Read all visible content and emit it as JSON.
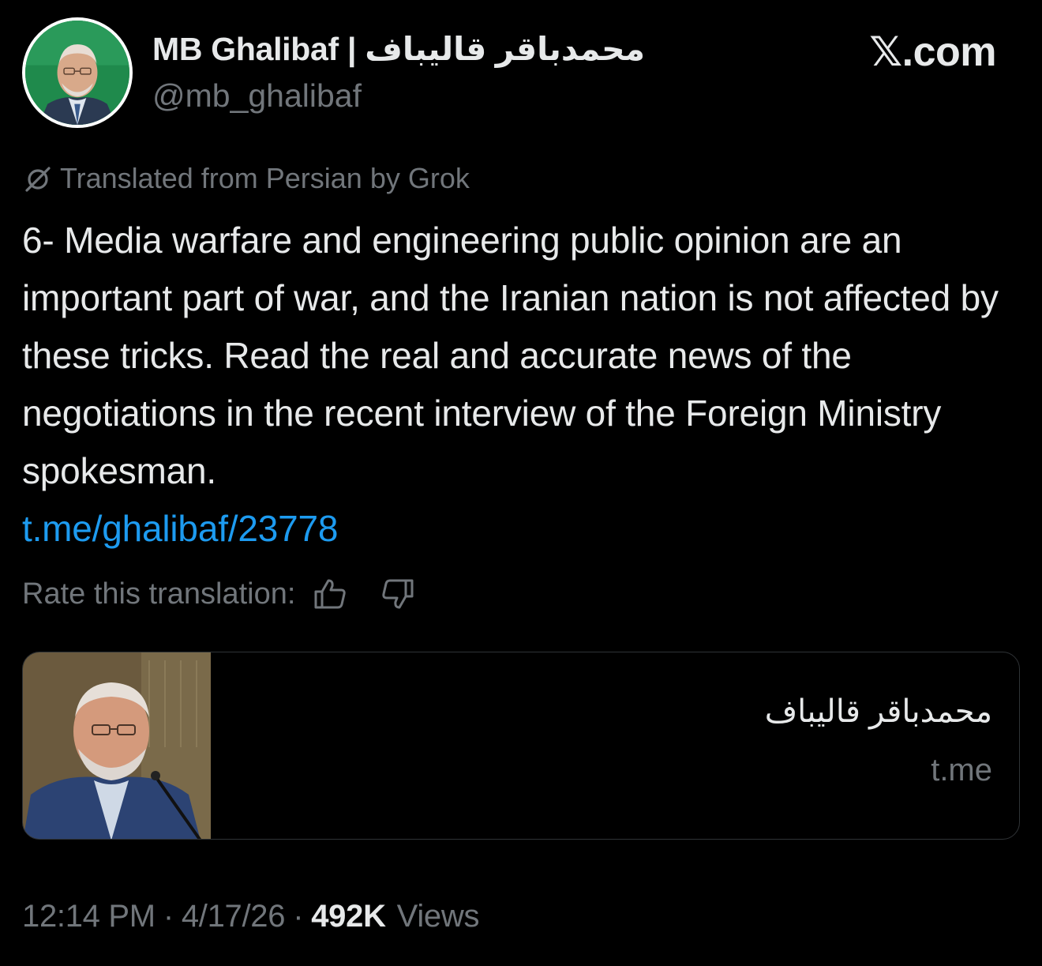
{
  "tweet": {
    "author": {
      "display_name": "MB Ghalibaf | محمدباقر قالیباف",
      "handle": "@mb_ghalibaf",
      "avatar": "profile-photo"
    },
    "brand": "𝕏.com",
    "translation_note": "Translated from Persian by Grok",
    "text": "6- Media warfare and engineering public opinion are an important part of war, and the Iranian nation is not affected by these tricks. Read the real and accurate news of the negotiations in the recent interview of the Foreign Ministry spokesman.",
    "link": "t.me/ghalibaf/23778",
    "rate_prompt": "Rate this translation:",
    "link_card": {
      "title": "محمدباقر قالیباف",
      "domain": "t.me"
    },
    "meta": {
      "time": "12:14 PM",
      "date": "4/17/26",
      "views_count": "492K",
      "views_label": "Views",
      "separator": "·"
    }
  },
  "colors": {
    "background": "#000000",
    "primary_text": "#e7e9ea",
    "secondary_text": "#71767b",
    "link": "#1d9bf0",
    "card_border": "#2f3336",
    "avatar_background": "#1f8a4c"
  },
  "icons": [
    "translate-slash-icon",
    "thumbs-up-icon",
    "thumbs-down-icon"
  ]
}
